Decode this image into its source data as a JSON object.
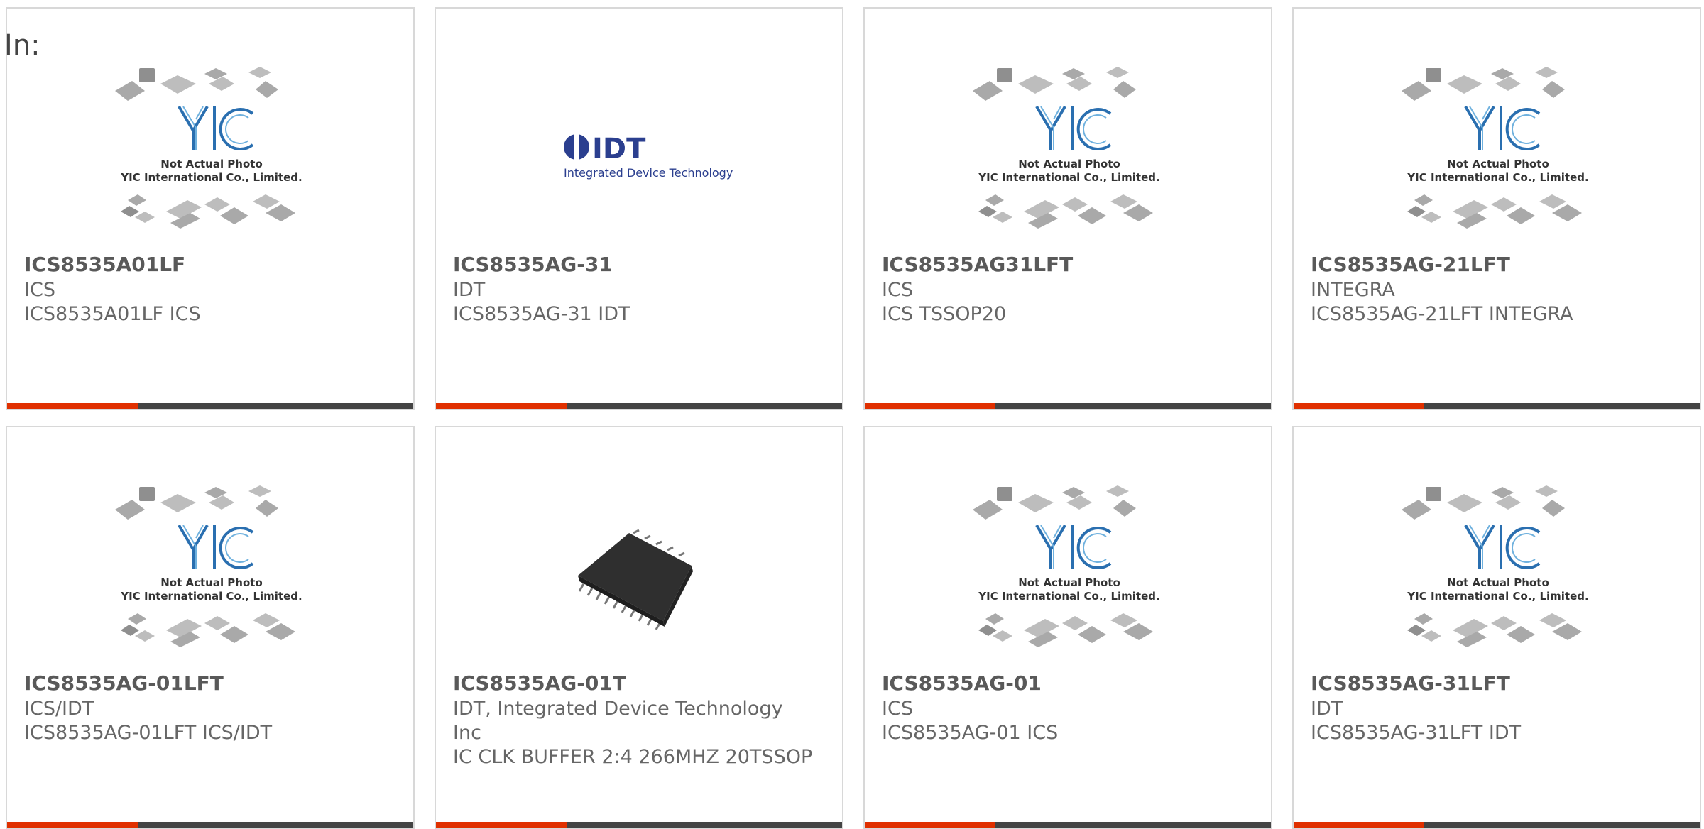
{
  "header": {
    "in_label": "In:"
  },
  "colors": {
    "accent": "#e03000",
    "bar": "#444444",
    "border": "#d8d8d8",
    "logo_blue": "#2a6fb0",
    "idt_blue": "#2b3f8f"
  },
  "placeholder": {
    "line1": "Not Actual Photo",
    "line2": "YIC International Co., Limited.",
    "logo_text": "YIC"
  },
  "idt_logo": {
    "mark": "IDT",
    "tagline": "Integrated Device Technology"
  },
  "products": [
    {
      "title": "ICS8535A01LF",
      "brand": "ICS",
      "desc": "ICS8535A01LF ICS",
      "image": "placeholder"
    },
    {
      "title": "ICS8535AG-31",
      "brand": "IDT",
      "desc": "ICS8535AG-31 IDT",
      "image": "idt-logo"
    },
    {
      "title": "ICS8535AG31LFT",
      "brand": "ICS",
      "desc": "ICS TSSOP20",
      "image": "placeholder"
    },
    {
      "title": "ICS8535AG-21LFT",
      "brand": "INTEGRA",
      "desc": "ICS8535AG-21LFT INTEGRA",
      "image": "placeholder"
    },
    {
      "title": "ICS8535AG-01LFT",
      "brand": "ICS/IDT",
      "desc": "ICS8535AG-01LFT ICS/IDT",
      "image": "placeholder"
    },
    {
      "title": "ICS8535AG-01T",
      "brand": "IDT, Integrated Device Technology Inc",
      "desc": "IC CLK BUFFER 2:4 266MHZ 20TSSOP",
      "image": "tssop-chip"
    },
    {
      "title": "ICS8535AG-01",
      "brand": "ICS",
      "desc": "ICS8535AG-01 ICS",
      "image": "placeholder"
    },
    {
      "title": "ICS8535AG-31LFT",
      "brand": "IDT",
      "desc": "ICS8535AG-31LFT IDT",
      "image": "placeholder"
    }
  ]
}
